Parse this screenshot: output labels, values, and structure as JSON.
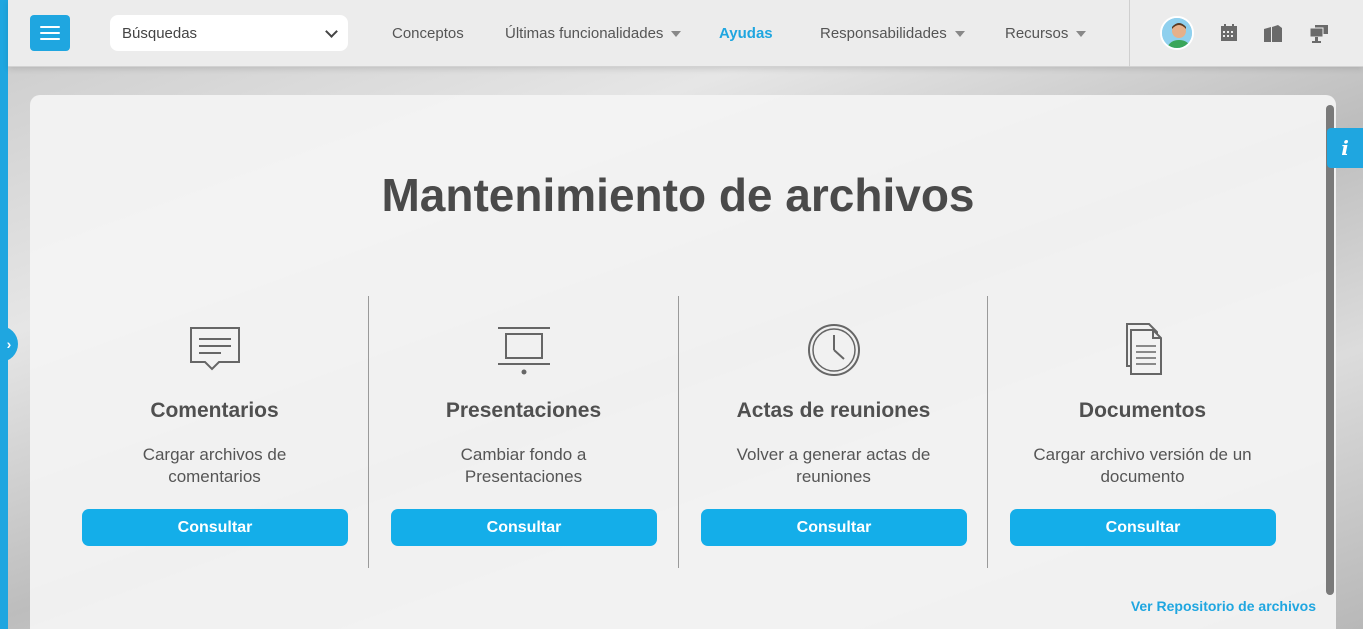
{
  "header": {
    "search_select": "Búsquedas",
    "nav": [
      {
        "label": "Conceptos"
      },
      {
        "label": "Últimas funcionalidades"
      },
      {
        "label": "Ayudas"
      },
      {
        "label": "Responsabilidades"
      },
      {
        "label": "Recursos"
      }
    ]
  },
  "main": {
    "title": "Mantenimiento de archivos",
    "items": [
      {
        "title": "Comentarios",
        "description": "Cargar archivos de comentarios",
        "button": "Consultar",
        "icon": "comment-icon"
      },
      {
        "title": "Presentaciones",
        "description": "Cambiar fondo a Presentaciones",
        "button": "Consultar",
        "icon": "presentation-icon"
      },
      {
        "title": "Actas de reuniones",
        "description": "Volver a generar actas de reuniones",
        "button": "Consultar",
        "icon": "clock-icon"
      },
      {
        "title": "Documentos",
        "description": "Cargar archivo versión de un documento",
        "button": "Consultar",
        "icon": "documents-icon"
      }
    ],
    "repo_link": "Ver Repositorio de archivos"
  },
  "info_tab": "i",
  "colors": {
    "accent": "#1fa6e0",
    "button": "#14aee9",
    "title": "#4a4a4a"
  }
}
